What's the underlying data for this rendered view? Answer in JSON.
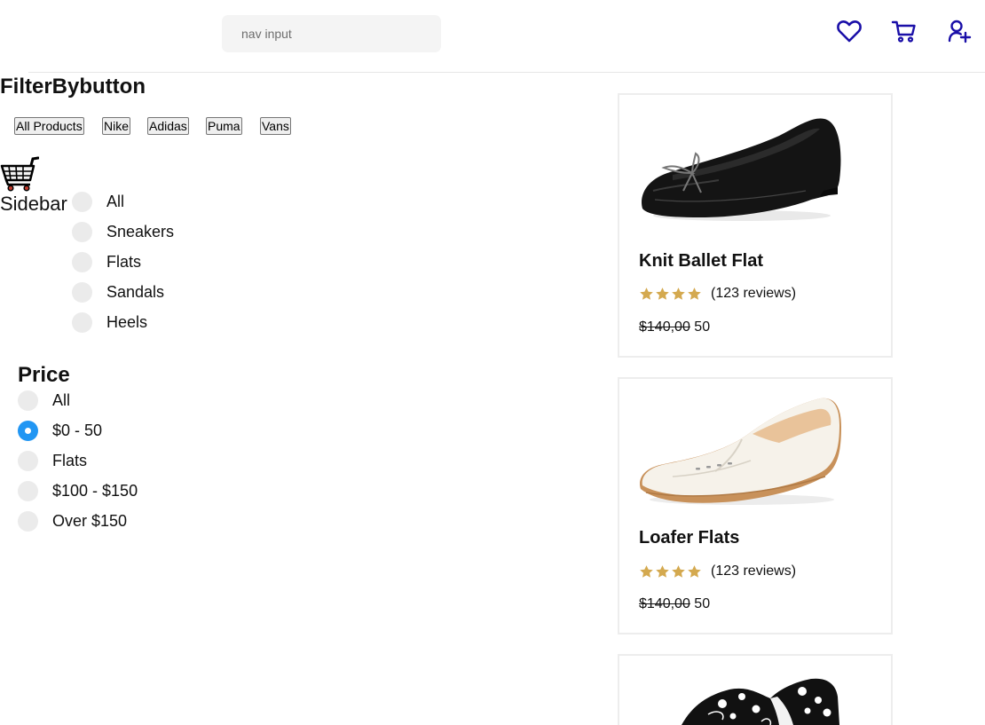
{
  "nav": {
    "search_placeholder": "nav input",
    "icons": [
      "heart-icon",
      "cart-icon",
      "user-add-icon"
    ],
    "icon_color": "#1a0fa8"
  },
  "filter": {
    "title": "FilterBybutton",
    "brands": [
      "All Products",
      "Nike",
      "Adidas",
      "Puma",
      "Vans"
    ]
  },
  "sidebar": {
    "label": "Sidebar",
    "logo_icon": "shopping-cart-icon",
    "categories": [
      "All",
      "Sneakers",
      "Flats",
      "Sandals",
      "Heels"
    ]
  },
  "price": {
    "title": "Price",
    "options": [
      "All",
      "$0 - 50",
      "Flats",
      "$100 - $150",
      "Over $150"
    ],
    "selected": "$0 - 50",
    "accent": "#2196f3"
  },
  "products": [
    {
      "title": "Knit Ballet Flat",
      "rating": 4,
      "reviews": "(123 reviews)",
      "old_price": "$140,00",
      "new_price": "50",
      "image": "black-ballet-flat"
    },
    {
      "title": "Loafer Flats",
      "rating": 4,
      "reviews": "(123 reviews)",
      "old_price": "$140,00",
      "new_price": "50",
      "image": "white-loafer-flat"
    },
    {
      "title": "",
      "rating": 0,
      "reviews": "",
      "old_price": "",
      "new_price": "",
      "image": "skull-print-slip-on"
    }
  ],
  "star_color": "#d4a94f"
}
